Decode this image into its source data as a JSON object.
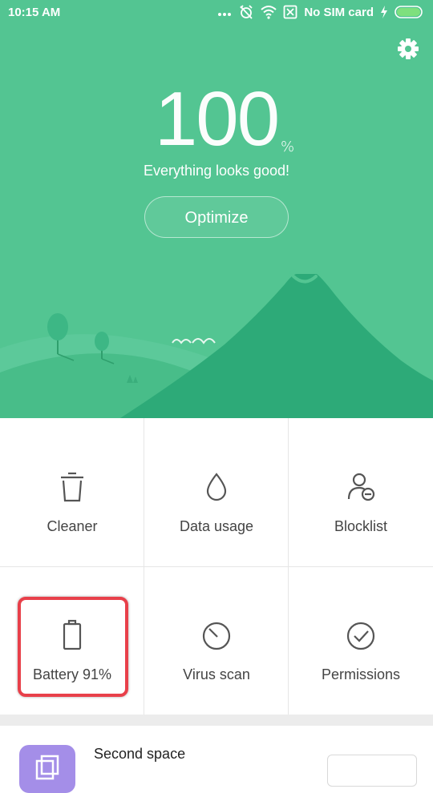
{
  "status_bar": {
    "time": "10:15 AM",
    "carrier": "No SIM card",
    "icons": [
      "more-dots-icon",
      "alarm-off-icon",
      "wifi-icon",
      "no-sim-icon",
      "charging-icon",
      "battery-icon"
    ]
  },
  "header": {
    "settings_icon": "gear-icon",
    "score": "100",
    "score_unit": "%",
    "subtitle": "Everything looks good!",
    "optimize_label": "Optimize"
  },
  "tools": [
    {
      "label": "Cleaner",
      "icon": "trash-icon"
    },
    {
      "label": "Data usage",
      "icon": "droplet-icon"
    },
    {
      "label": "Blocklist",
      "icon": "user-block-icon"
    },
    {
      "label": "Battery 91%",
      "icon": "battery-icon"
    },
    {
      "label": "Virus scan",
      "icon": "scan-icon"
    },
    {
      "label": "Permissions",
      "icon": "check-circle-icon"
    }
  ],
  "second_space": {
    "title": "Second space",
    "icon": "second-space-icon"
  },
  "colors": {
    "hero_green": "#53c592",
    "hill_dark": "#2daa78",
    "hill_mid": "#3db785",
    "highlight_red": "#e8404a",
    "label_gray": "#444444",
    "icon_gray": "#555555",
    "second_space_purple": "#a48ee8"
  }
}
